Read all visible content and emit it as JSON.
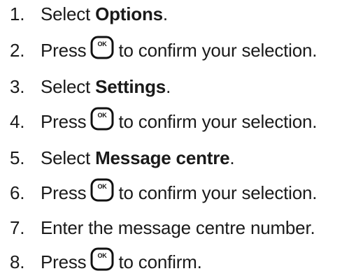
{
  "steps": [
    {
      "num": "1.",
      "pre": "Select ",
      "bold": "Options",
      "post": "."
    },
    {
      "num": "2.",
      "pre": "Press",
      "key": "OK",
      "post": "to confirm your selection."
    },
    {
      "num": "3.",
      "pre": "Select ",
      "bold": "Settings",
      "post": "."
    },
    {
      "num": "4.",
      "pre": "Press",
      "key": "OK",
      "post": "to confirm your selection."
    },
    {
      "num": "5.",
      "pre": "Select ",
      "bold": "Message centre",
      "post": "."
    },
    {
      "num": "6.",
      "pre": "Press",
      "key": "OK",
      "post": "to confirm your selection."
    },
    {
      "num": "7.",
      "pre": "Enter the message centre number."
    },
    {
      "num": "8.",
      "pre": "Press",
      "key": "OK",
      "post": "to confirm."
    }
  ],
  "icons": {
    "ok_key": "ok-key-icon"
  }
}
